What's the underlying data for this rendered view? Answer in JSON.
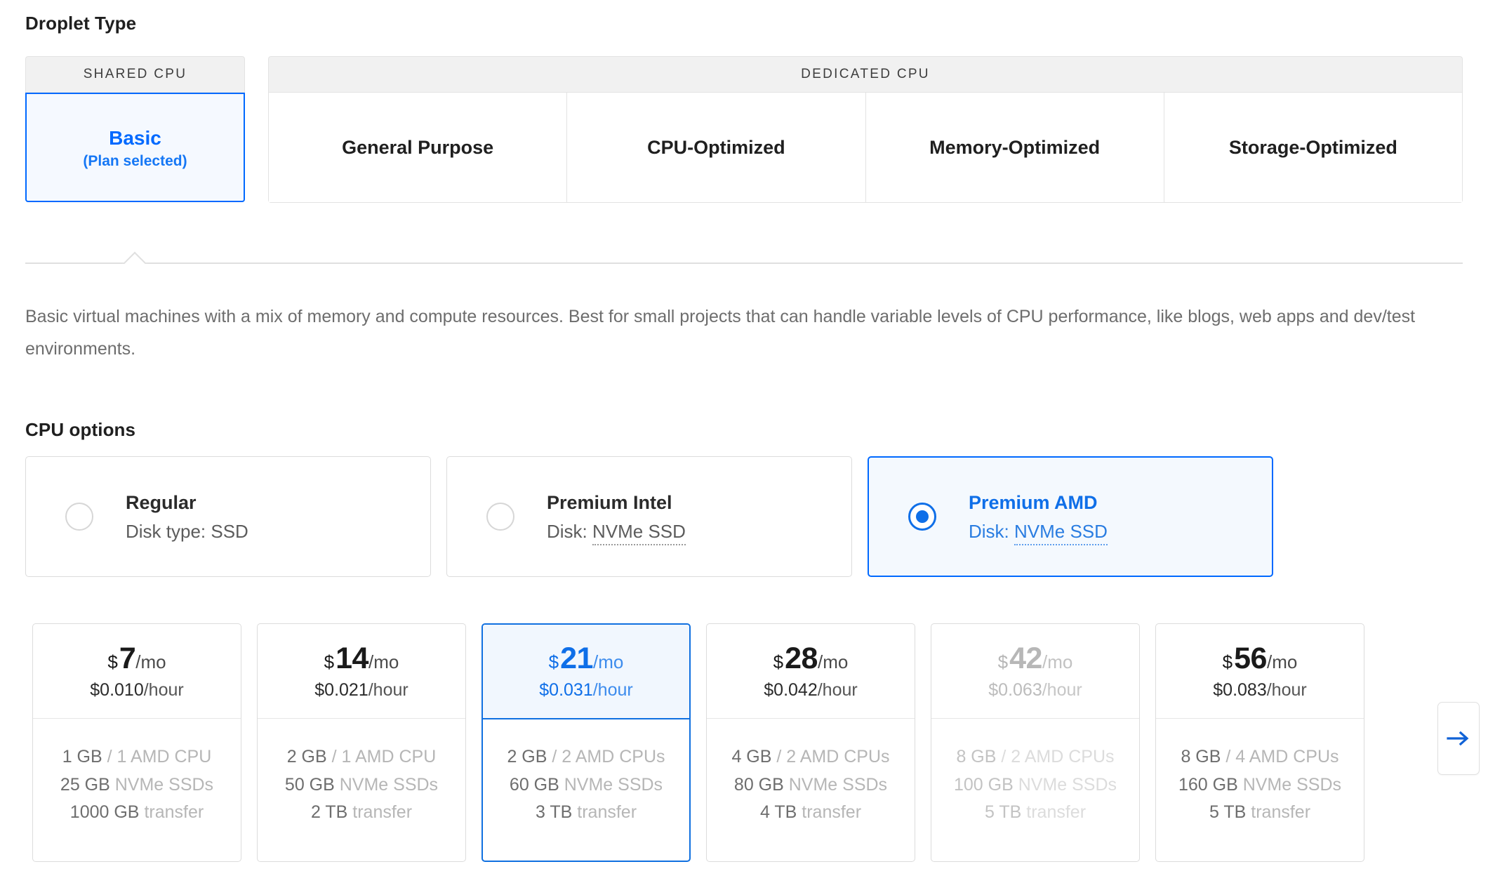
{
  "droplet_type": {
    "heading": "Droplet Type",
    "groups": [
      {
        "label": "SHARED CPU",
        "tabs": [
          {
            "title": "Basic",
            "sub": "(Plan selected)",
            "selected": true
          }
        ]
      },
      {
        "label": "DEDICATED CPU",
        "tabs": [
          {
            "title": "General Purpose",
            "selected": false
          },
          {
            "title": "CPU-Optimized",
            "selected": false
          },
          {
            "title": "Memory-Optimized",
            "selected": false
          },
          {
            "title": "Storage-Optimized",
            "selected": false
          }
        ]
      }
    ],
    "description": "Basic virtual machines with a mix of memory and compute resources. Best for small projects that can handle variable levels of CPU performance, like blogs, web apps and dev/test environments."
  },
  "cpu_options": {
    "heading": "CPU options",
    "options": [
      {
        "title": "Regular",
        "sub_prefix": "Disk type: ",
        "sub_value": "SSD",
        "tooltip": false,
        "selected": false
      },
      {
        "title": "Premium Intel",
        "sub_prefix": "Disk: ",
        "sub_value": "NVMe SSD",
        "tooltip": true,
        "selected": false
      },
      {
        "title": "Premium AMD",
        "sub_prefix": "Disk: ",
        "sub_value": "NVMe SSD",
        "tooltip": true,
        "selected": true
      }
    ]
  },
  "plans": [
    {
      "currency": "$",
      "monthly": "7",
      "per": "/mo",
      "hourly": "$0.010",
      "hourly_unit": "/hour",
      "memory": "1 GB",
      "cpu": "/ 1 AMD CPU",
      "disk": "25 GB",
      "disk_label": "NVMe SSDs",
      "transfer": "1000 GB",
      "transfer_label": "transfer",
      "selected": false,
      "disabled": false
    },
    {
      "currency": "$",
      "monthly": "14",
      "per": "/mo",
      "hourly": "$0.021",
      "hourly_unit": "/hour",
      "memory": "2 GB",
      "cpu": "/ 1 AMD CPU",
      "disk": "50 GB",
      "disk_label": "NVMe SSDs",
      "transfer": "2 TB",
      "transfer_label": "transfer",
      "selected": false,
      "disabled": false
    },
    {
      "currency": "$",
      "monthly": "21",
      "per": "/mo",
      "hourly": "$0.031",
      "hourly_unit": "/hour",
      "memory": "2 GB",
      "cpu": "/ 2 AMD CPUs",
      "disk": "60 GB",
      "disk_label": "NVMe SSDs",
      "transfer": "3 TB",
      "transfer_label": "transfer",
      "selected": true,
      "disabled": false
    },
    {
      "currency": "$",
      "monthly": "28",
      "per": "/mo",
      "hourly": "$0.042",
      "hourly_unit": "/hour",
      "memory": "4 GB",
      "cpu": "/ 2 AMD CPUs",
      "disk": "80 GB",
      "disk_label": "NVMe SSDs",
      "transfer": "4 TB",
      "transfer_label": "transfer",
      "selected": false,
      "disabled": false
    },
    {
      "currency": "$",
      "monthly": "42",
      "per": "/mo",
      "hourly": "$0.063",
      "hourly_unit": "/hour",
      "memory": "8 GB",
      "cpu": "/ 2 AMD CPUs",
      "disk": "100 GB",
      "disk_label": "NVMe SSDs",
      "transfer": "5 TB",
      "transfer_label": "transfer",
      "selected": false,
      "disabled": true
    },
    {
      "currency": "$",
      "monthly": "56",
      "per": "/mo",
      "hourly": "$0.083",
      "hourly_unit": "/hour",
      "memory": "8 GB",
      "cpu": "/ 4 AMD CPUs",
      "disk": "160 GB",
      "disk_label": "NVMe SSDs",
      "transfer": "5 TB",
      "transfer_label": "transfer",
      "selected": false,
      "disabled": false
    }
  ],
  "scroll": {
    "next_icon": "arrow-right-icon"
  },
  "colors": {
    "accent": "#0069ff",
    "accent_dark": "#0f6fe8",
    "selected_bg": "#f4f9fe",
    "border": "#dcdcdc",
    "muted": "#b6b6b6"
  }
}
